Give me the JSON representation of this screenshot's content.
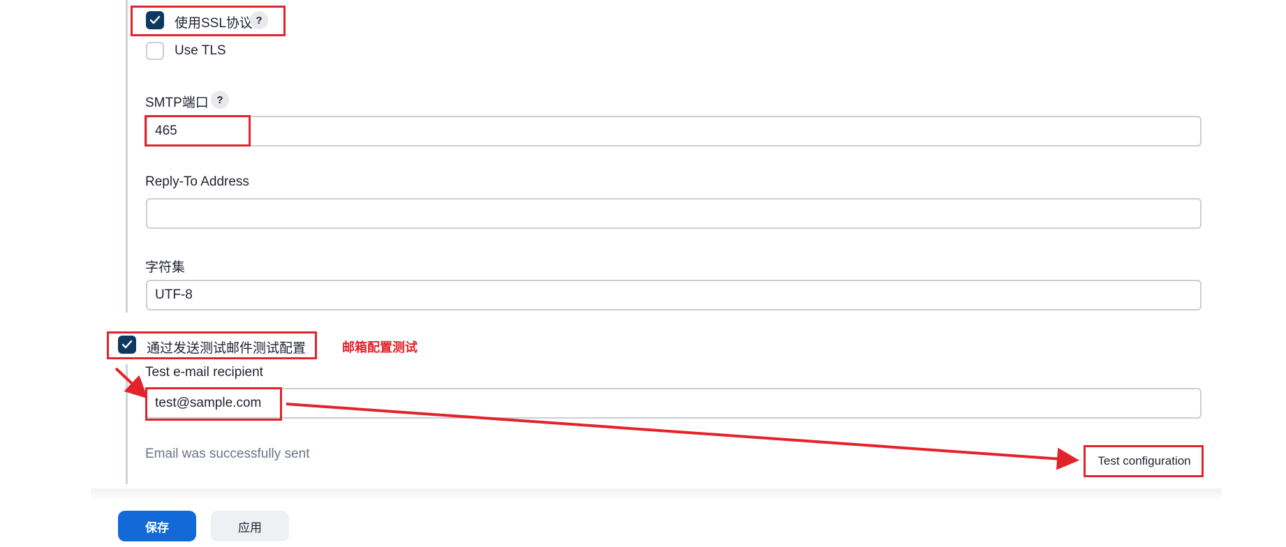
{
  "ssl": {
    "label": "使用SSL协议",
    "checked": true,
    "help": "?"
  },
  "tls": {
    "label": "Use TLS",
    "checked": false
  },
  "smtp_port": {
    "label": "SMTP端口",
    "help": "?",
    "value": "465"
  },
  "reply_to": {
    "label": "Reply-To Address",
    "value": ""
  },
  "charset": {
    "label": "字符集",
    "value": "UTF-8"
  },
  "test_section": {
    "checkbox_label": "通过发送测试邮件测试配置",
    "checked": true,
    "annotation": "邮箱配置测试",
    "recipient_label": "Test e-mail recipient",
    "recipient_value": "test@sample.com",
    "status": "Email was successfully sent",
    "test_button": "Test configuration"
  },
  "footer": {
    "save": "保存",
    "apply": "应用"
  },
  "colors": {
    "primary": "#1469d8",
    "checkbox": "#0e3a5f",
    "annotation_red": "#e3232a",
    "status_text": "#6b7386"
  },
  "icons": {
    "check": "checkmark-icon",
    "help": "question-mark-icon"
  }
}
